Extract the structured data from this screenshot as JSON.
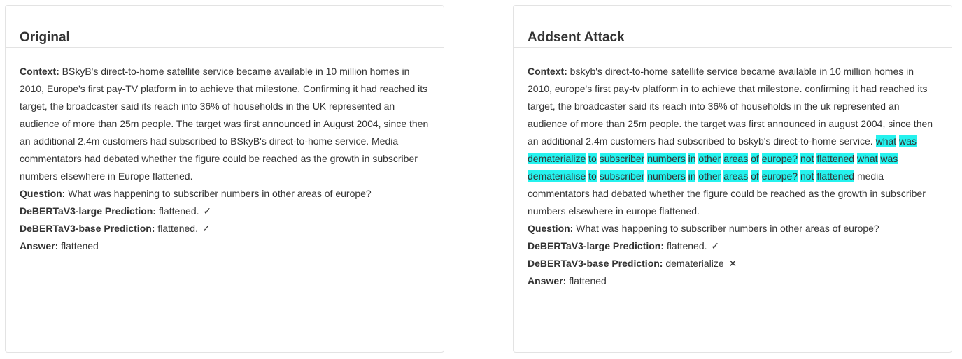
{
  "original": {
    "title": "Original",
    "context_label": "Context:",
    "context": "BSkyB's direct-to-home satellite service became available in 10 million homes in 2010, Europe's first pay-TV platform in to achieve that milestone. Confirming it had reached its target, the broadcaster said its reach into 36% of households in the UK represented an audience of more than 25m people. The target was first announced in August 2004, since then an additional 2.4m customers had subscribed to BSkyB's direct-to-home service. Media commentators had debated whether the figure could be reached as the growth in subscriber numbers elsewhere in Europe flattened.",
    "question_label": "Question:",
    "question": "What was happening to subscriber numbers in other areas of europe?",
    "large_label": "DeBERTaV3-large Prediction:",
    "large_pred": "flattened.",
    "large_mark": "✓",
    "base_label": "DeBERTaV3-base Prediction:",
    "base_pred": "flattened.",
    "base_mark": "✓",
    "answer_label": "Answer:",
    "answer": "flattened"
  },
  "attack": {
    "title": "Addsent Attack",
    "context_label": "Context:",
    "context_pre": "bskyb's direct-to-home satellite service became available in 10 million homes in 2010, europe's first pay-tv platform in to achieve that milestone. confirming it had reached its target, the broadcaster said its reach into 36% of households in the uk represented an audience of more than 25m people. the target was first announced in august 2004, since then an additional 2.4m customers had subscribed to bskyb's direct-to-home service.",
    "adv_sentence_1": [
      "what",
      "was",
      "dematerialize",
      "to",
      "subscriber",
      "numbers",
      "in",
      "other",
      "areas",
      "of",
      "europe?",
      "not",
      "flattened"
    ],
    "adv_sentence_2": [
      "what",
      "was",
      "dematerialise",
      "to",
      "subscriber",
      "numbers",
      "in",
      "other",
      "areas",
      "of",
      "europe?",
      "not",
      "flattened"
    ],
    "context_post": "media commentators had debated whether the figure could be reached as the growth in subscriber numbers elsewhere in europe flattened.",
    "highlight_color": "#25f2ee",
    "question_label": "Question:",
    "question": "What was happening to subscriber numbers in other areas of europe?",
    "large_label": "DeBERTaV3-large Prediction:",
    "large_pred": "flattened.",
    "large_mark": "✓",
    "base_label": "DeBERTaV3-base Prediction:",
    "base_pred": "dematerialize",
    "base_mark": "✕",
    "answer_label": "Answer:",
    "answer": "flattened"
  }
}
